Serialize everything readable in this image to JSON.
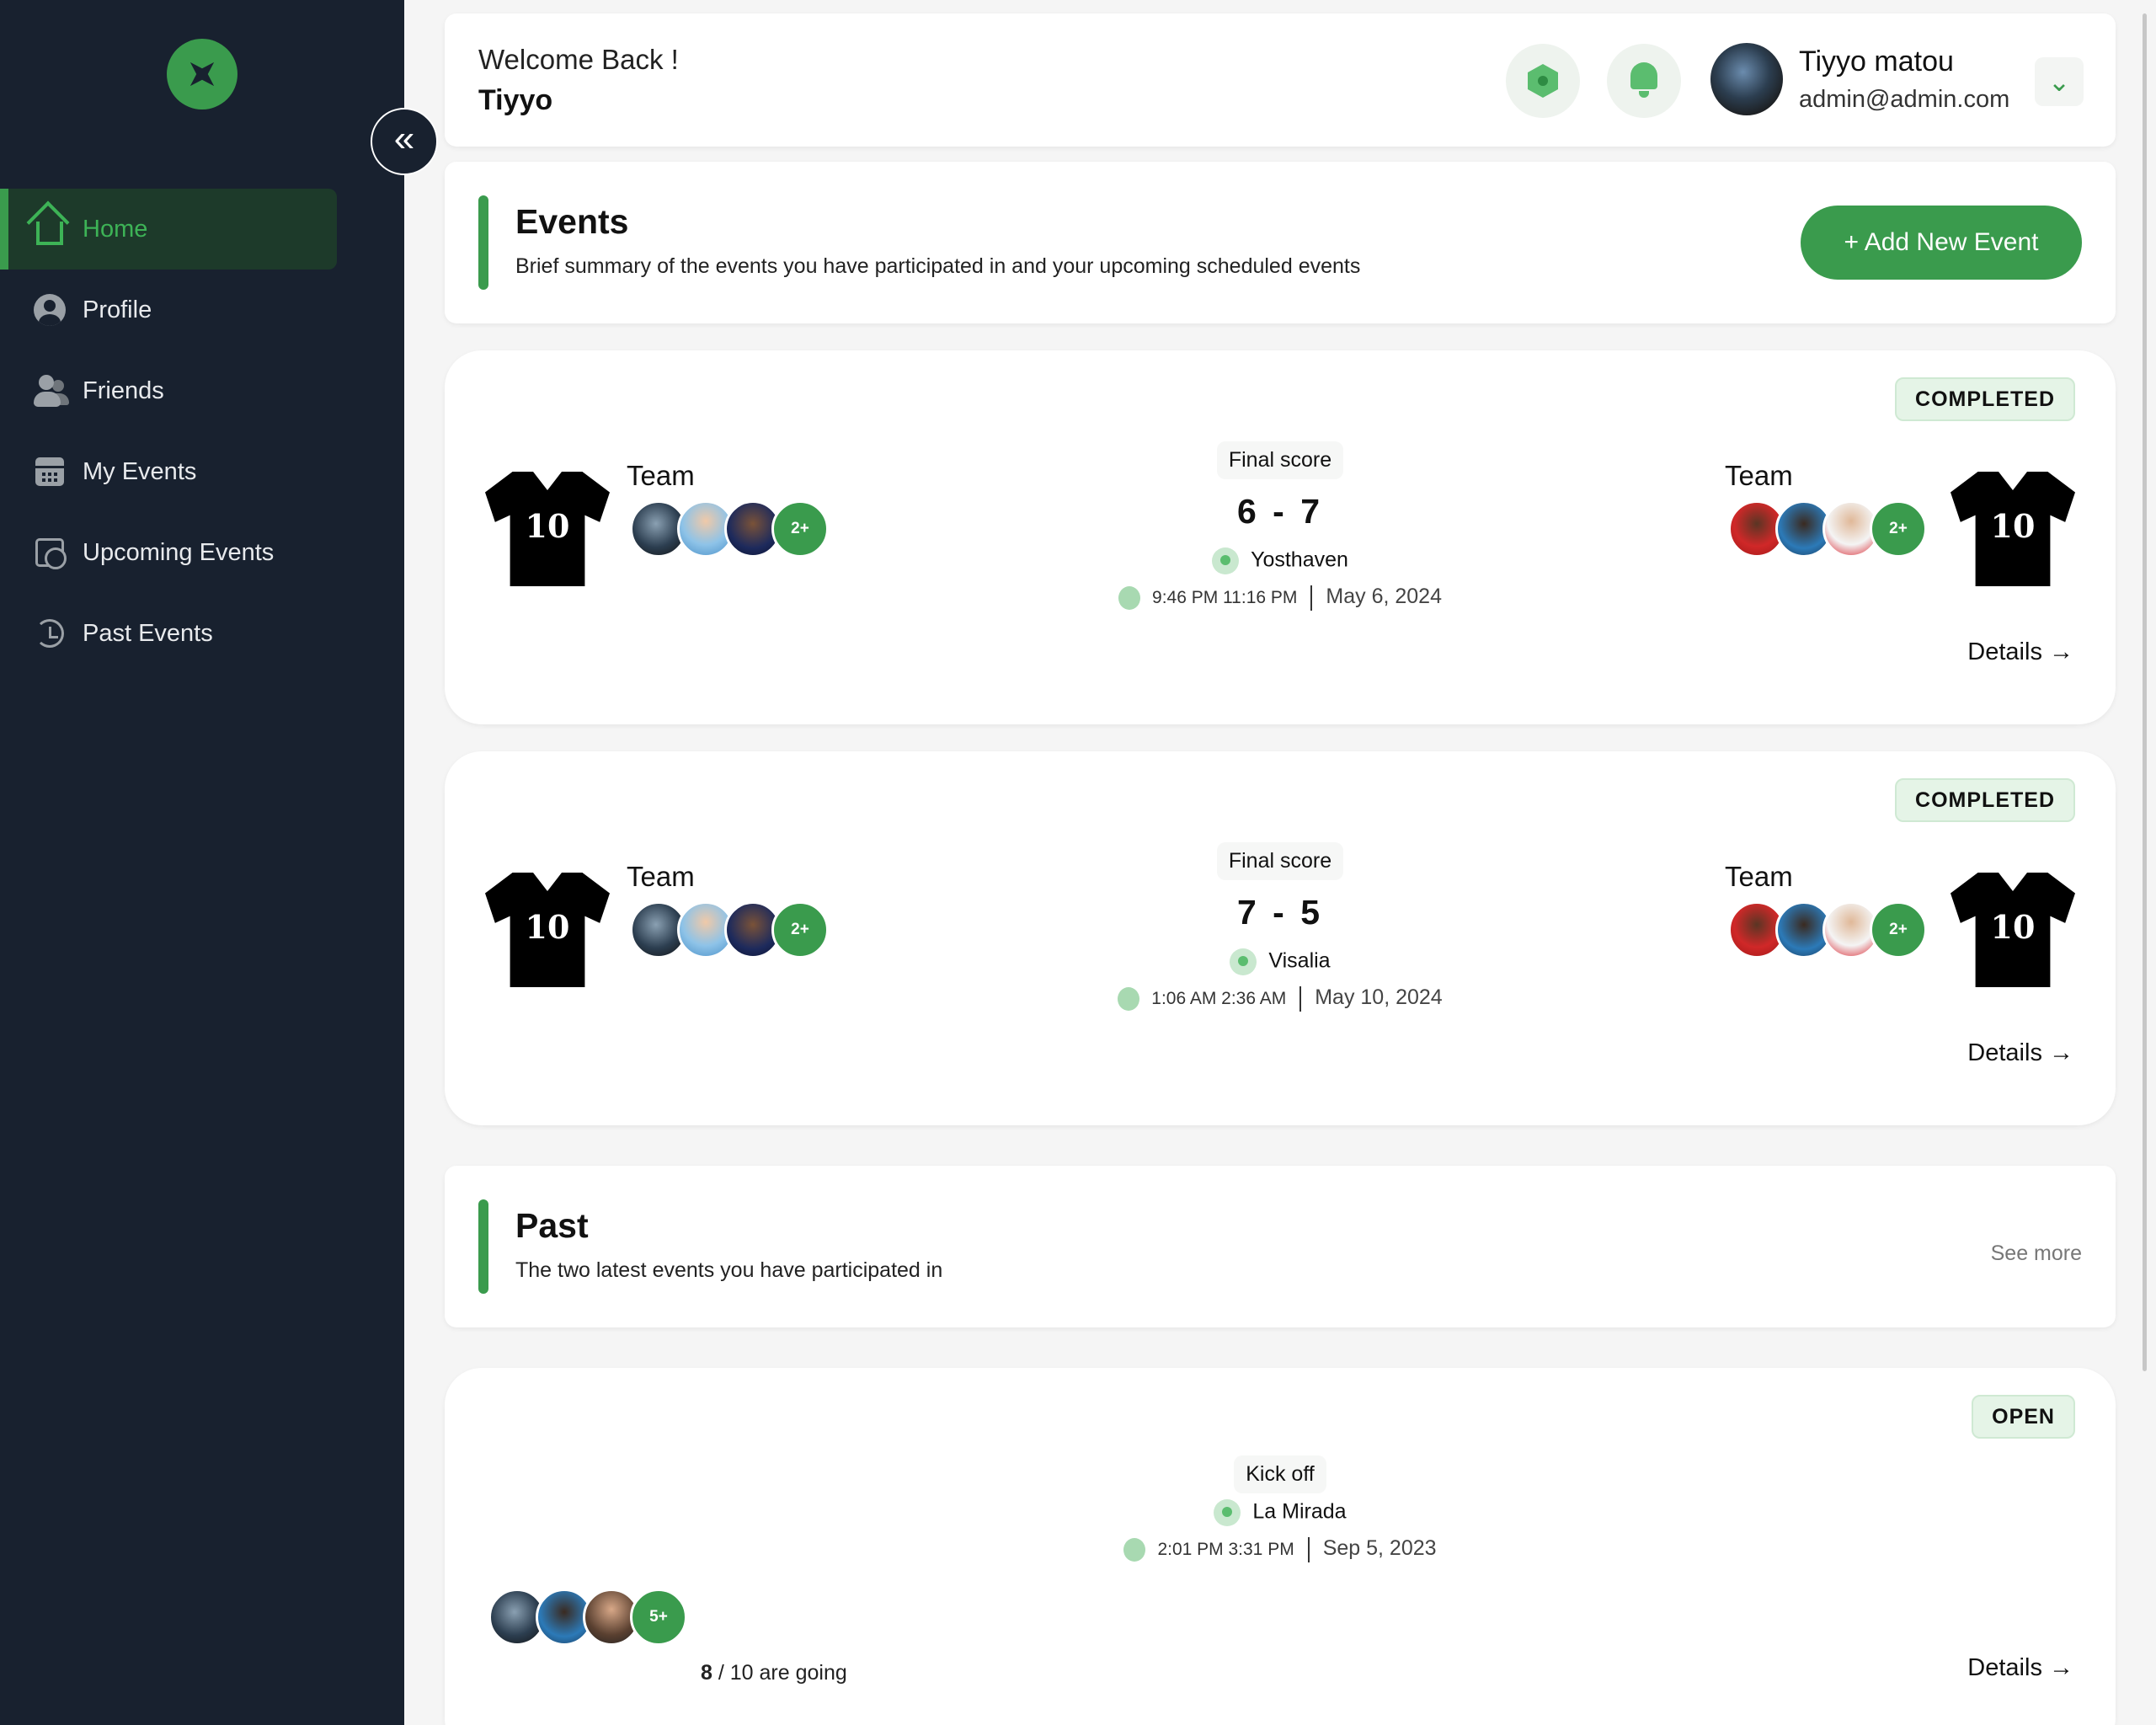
{
  "sidebar": {
    "items": [
      {
        "label": "Home",
        "icon": "home-icon",
        "active": true
      },
      {
        "label": "Profile",
        "icon": "user-icon"
      },
      {
        "label": "Friends",
        "icon": "friends-icon"
      },
      {
        "label": "My Events",
        "icon": "calendar-icon"
      },
      {
        "label": "Upcoming Events",
        "icon": "calendar-clock-icon"
      },
      {
        "label": "Past Events",
        "icon": "history-icon"
      }
    ],
    "collapse_glyph": "«"
  },
  "header": {
    "welcome": "Welcome Back !",
    "name": "Tiyyo",
    "user_name": "Tiyyo matou",
    "user_email": "admin@admin.com",
    "dropdown_glyph": "⌄"
  },
  "events_section": {
    "title": "Events",
    "subtitle": "Brief summary of the events you have participated in and your upcoming scheduled events",
    "add_button": "+ Add New Event"
  },
  "events": [
    {
      "status": "COMPLETED",
      "team_left": "Team",
      "team_right": "Team",
      "jersey_number": "10",
      "more_left": "2+",
      "more_right": "2+",
      "score_label": "Final score",
      "score": "6 - 7",
      "location": "Yosthaven",
      "time": "9:46 PM 11:16 PM",
      "date": "May 6, 2024",
      "details": "Details →"
    },
    {
      "status": "COMPLETED",
      "team_left": "Team",
      "team_right": "Team",
      "jersey_number": "10",
      "more_left": "2+",
      "more_right": "2+",
      "score_label": "Final score",
      "score": "7 - 5",
      "location": "Visalia",
      "time": "1:06 AM 2:36 AM",
      "date": "May 10, 2024",
      "details": "Details →"
    }
  ],
  "past_section": {
    "title": "Past",
    "subtitle": "The two latest events you have participated in",
    "see_more": "See more"
  },
  "past_event": {
    "status": "OPEN",
    "label": "Kick off",
    "location": "La Mirada",
    "time": "2:01 PM 3:31 PM",
    "date": "Sep 5, 2023",
    "more": "5+",
    "going_count": "8",
    "going_text": " / 10 are going",
    "details": "Details →"
  },
  "colors": {
    "accent": "#3a9b4d",
    "sidebar": "#18212f",
    "background": "#f5f5f5"
  }
}
